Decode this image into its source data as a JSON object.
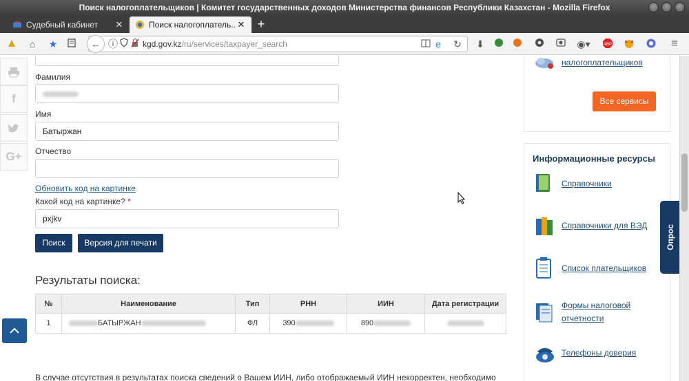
{
  "window": {
    "title": "Поиск налогоплательщиков | Комитет государственных доходов Министерства финансов Республики Казахстан - Mozilla Firefox"
  },
  "tabs": [
    {
      "label": "Судебный кабинет",
      "active": false,
      "icon": "court-icon"
    },
    {
      "label": "Поиск налогоплатель...",
      "active": true,
      "icon": "kgd-emblem-icon"
    }
  ],
  "newtab": {
    "label": "+"
  },
  "urlbar": {
    "host": "kgd.gov.kz",
    "path": "/ru/services/taxpayer_search"
  },
  "form": {
    "surname_label": "Фамилия",
    "name_label": "Имя",
    "name_value": "Батыржан",
    "patronymic_label": "Отчество",
    "patronymic_value": "",
    "refresh_captcha": "Обновить код на картинке",
    "captcha_label": "Какой код на картинке?",
    "required_mark": "*",
    "captcha_value": "pxjkv",
    "search_button": "Поиск",
    "print_button": "Версия для печати"
  },
  "results": {
    "heading": "Результаты поиска:",
    "columns": [
      "№",
      "Наименование",
      "Тип",
      "РНН",
      "ИИН",
      "Дата регистрации"
    ],
    "rows": [
      {
        "num": "1",
        "name": "БАТЫРЖАН",
        "type": "ФЛ",
        "rnn": "390",
        "iin": "890",
        "date": ""
      }
    ]
  },
  "bottom_text": "В случае отсутствия в результатах поиска сведений о Вашем ИИН, либо отображаемый ИИН некорректен, необходимо",
  "sidebar": {
    "top_link": "налогоплательщиков",
    "all_services_button": "Все сервисы",
    "resources_title": "Информационные ресурсы",
    "items": [
      {
        "label": "Справочники",
        "icon": "book-icon"
      },
      {
        "label": "Справочники для ВЭД",
        "icon": "books-icon"
      },
      {
        "label": "Список плательщиков",
        "icon": "clipboard-icon"
      },
      {
        "label": "Формы налоговой отчетности",
        "icon": "forms-icon"
      },
      {
        "label": "Телефоны доверия",
        "icon": "phone-icon"
      }
    ]
  },
  "poll": {
    "label": "Опрос"
  },
  "colors": {
    "primary_button": "#163a63",
    "accent_orange": "#f26522",
    "link": "#1f5a86"
  }
}
